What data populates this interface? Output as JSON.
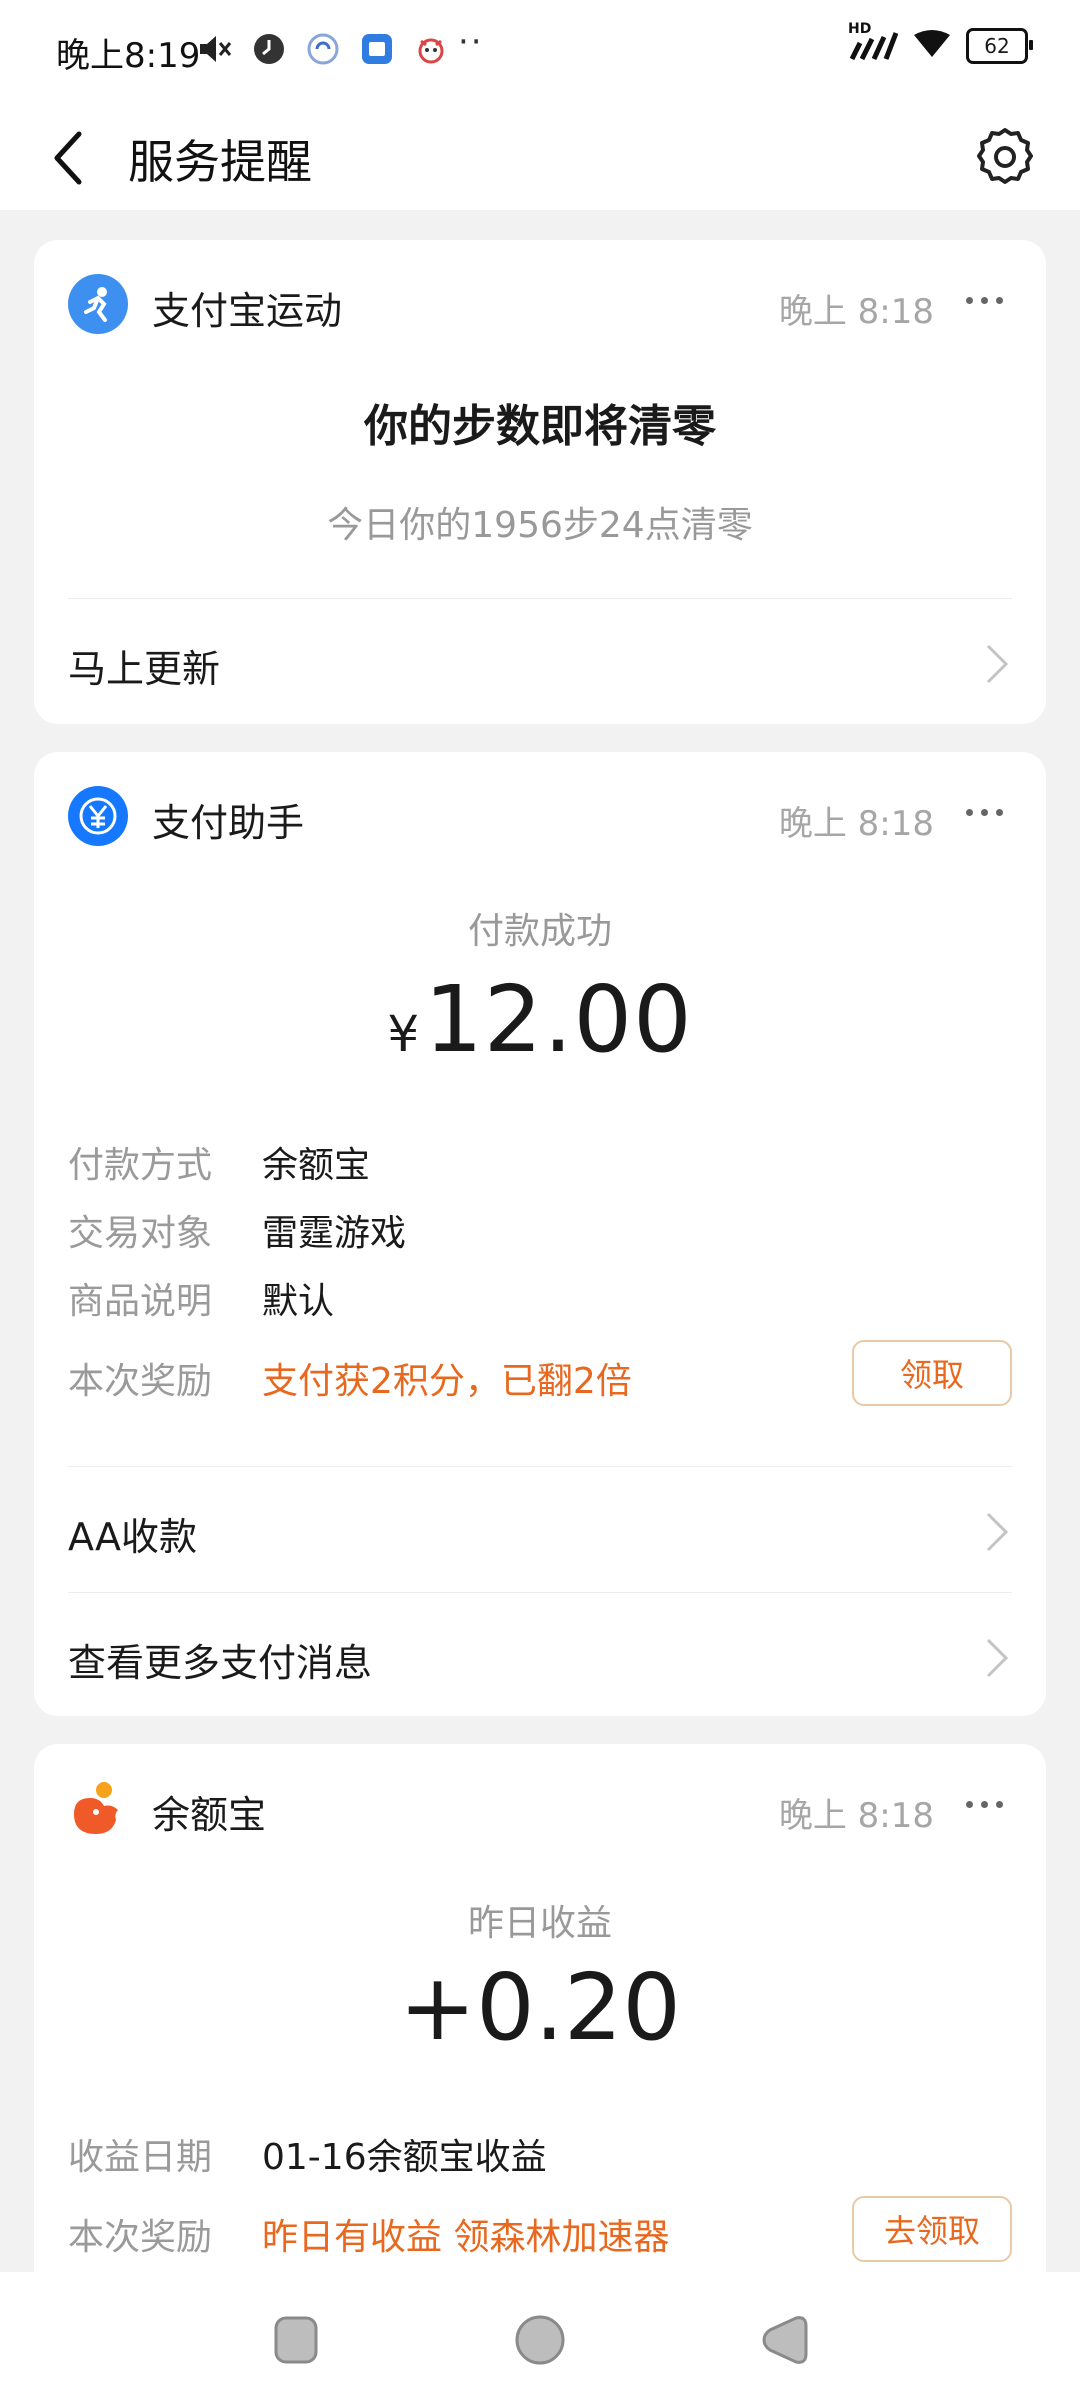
{
  "status_bar": {
    "time": "晚上8:19",
    "dots": "··",
    "signal_label": "HD",
    "battery": "62"
  },
  "header": {
    "title": "服务提醒"
  },
  "cards": {
    "sport": {
      "app_name": "支付宝运动",
      "time": "晚上 8:18",
      "headline": "你的步数即将清零",
      "subtext": "今日你的1956步24点清零",
      "action": "马上更新"
    },
    "payment": {
      "app_name": "支付助手",
      "time": "晚上 8:18",
      "status": "付款成功",
      "currency": "¥",
      "amount": "12.00",
      "fields": [
        {
          "key": "付款方式",
          "value": "余额宝"
        },
        {
          "key": "交易对象",
          "value": "雷霆游戏"
        },
        {
          "key": "商品说明",
          "value": "默认"
        }
      ],
      "reward_key": "本次奖励",
      "reward_value": "支付获2积分，已翻2倍",
      "reward_button": "领取",
      "links": [
        "AA收款",
        "查看更多支付消息"
      ]
    },
    "yuebao": {
      "app_name": "余额宝",
      "time": "晚上 8:18",
      "status": "昨日收益",
      "amount": "+0.20",
      "date_key": "收益日期",
      "date_value": "01-16余额宝收益",
      "reward_key": "本次奖励",
      "reward_value": "昨日有收益 领森林加速器",
      "reward_button": "去领取"
    }
  },
  "colors": {
    "accent_orange": "#e8681f",
    "sport_blue": "#3d8ff0",
    "pay_blue": "#1677ff",
    "yuebao_orange": "#f05a28"
  }
}
